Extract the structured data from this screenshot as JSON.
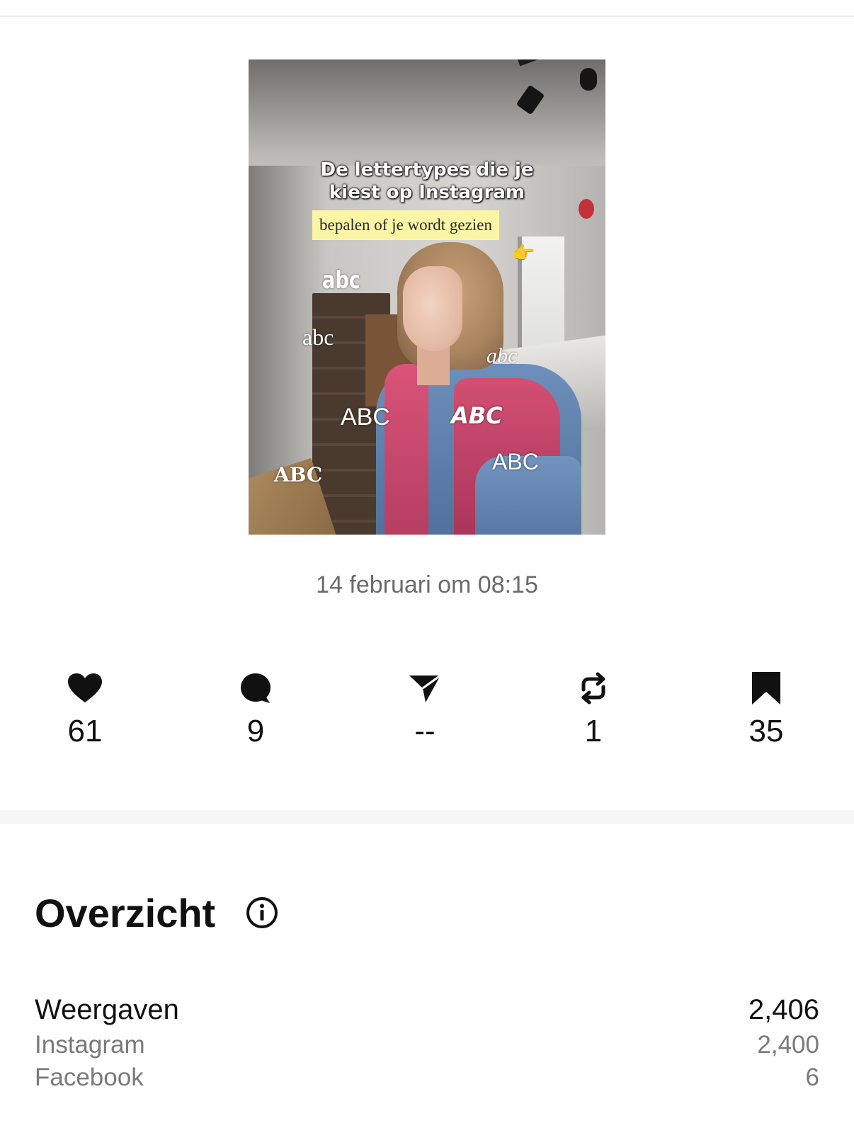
{
  "post": {
    "thumbnail": {
      "title_text": "De lettertypes die je\nkiest op Instagram",
      "highlight_text": "bepalen of je wordt gezien",
      "pointer_emoji": "👉",
      "font_samples": [
        "abc",
        "abc",
        "abc",
        "ABC",
        "ABC",
        "ABC",
        "ABC"
      ]
    },
    "timestamp": "14 februari om 08:15"
  },
  "stats": [
    {
      "icon": "heart-icon",
      "value": "61"
    },
    {
      "icon": "comment-icon",
      "value": "9"
    },
    {
      "icon": "share-icon",
      "value": "--"
    },
    {
      "icon": "repost-icon",
      "value": "1"
    },
    {
      "icon": "bookmark-icon",
      "value": "35"
    }
  ],
  "overview": {
    "title": "Overzicht",
    "info_icon": "info-icon",
    "views": {
      "label": "Weergaven",
      "value": "2,406"
    },
    "breakdown": [
      {
        "label": "Instagram",
        "value": "2,400"
      },
      {
        "label": "Facebook",
        "value": "6"
      }
    ]
  },
  "colors": {
    "text_primary": "#111111",
    "text_secondary": "#7a7a7a",
    "highlight": "#fbf6a6",
    "divider": "#f6f6f6"
  }
}
